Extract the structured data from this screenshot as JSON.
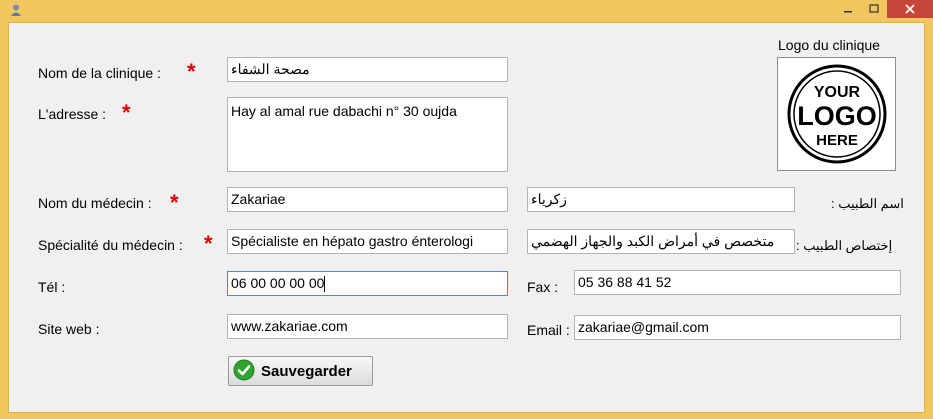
{
  "window": {
    "controls": {
      "minimize": "–",
      "maximize": "□",
      "close": "✕"
    }
  },
  "labels": {
    "clinic_name": "Nom de la clinique :",
    "address": "L'adresse :",
    "doctor_name": "Nom du médecin :",
    "specialty": "Spécialité du médecin :",
    "phone": "Tél :",
    "website": "Site web :",
    "fax": "Fax :",
    "email": "Email :",
    "doctor_name_ar": "اسم الطبيب :",
    "specialty_ar": "إختصاص الطبيب :",
    "required_marker": "*"
  },
  "fields": {
    "clinic_name": "مصحة الشفاء",
    "address": "Hay al amal rue dabachi n° 30 oujda",
    "doctor_name": "Zakariae",
    "doctor_name_ar": "زكرياء",
    "specialty": "Spécialiste en hépato gastro énterologi",
    "specialty_ar": "متخصص في أمراض الكبد والجهاز الهضمي",
    "phone": "06 00 00 00 00",
    "fax": "05 36 88 41 52",
    "website": "www.zakariae.com",
    "email": "zakariae@gmail.com"
  },
  "logo": {
    "title": "Logo du clinique",
    "line1": "YOUR",
    "line2": "LOGO",
    "line3": "HERE"
  },
  "actions": {
    "save_label": "Sauvegarder"
  },
  "colors": {
    "title_bar": "#f2c65e",
    "required_star": "#e00000",
    "focus_border": "#3d8ee6",
    "save_check": "#2fa52f"
  }
}
